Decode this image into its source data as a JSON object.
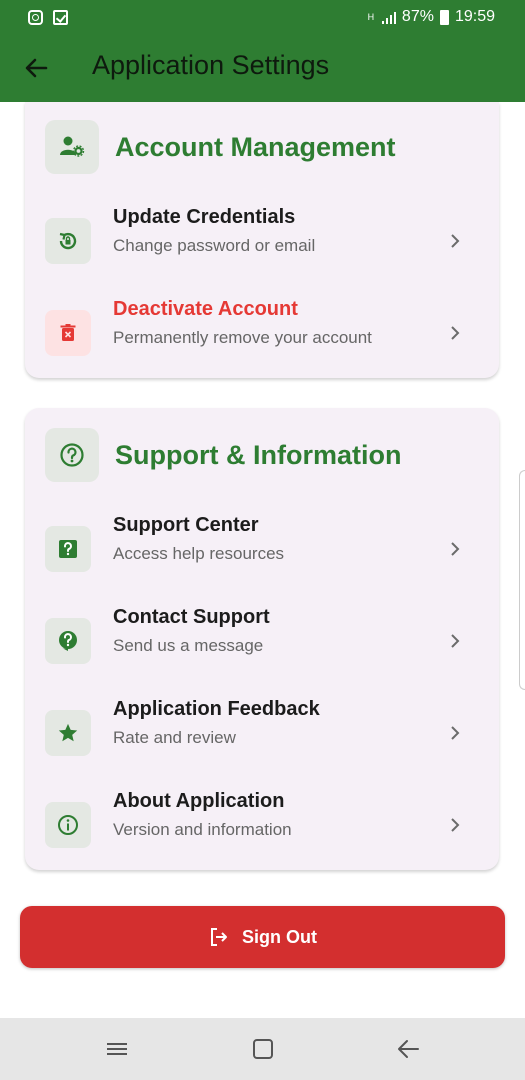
{
  "status_bar": {
    "battery": "87%",
    "time": "19:59",
    "network": "H"
  },
  "app_bar": {
    "title": "Application Settings"
  },
  "account_section": {
    "title": "Account Management",
    "items": [
      {
        "title": "Update Credentials",
        "subtitle": "Change password or email",
        "icon": "lock-reset-icon"
      },
      {
        "title": "Deactivate Account",
        "subtitle": "Permanently remove your account",
        "icon": "delete-icon"
      }
    ]
  },
  "support_section": {
    "title": "Support & Information",
    "items": [
      {
        "title": "Support Center",
        "subtitle": "Access help resources",
        "icon": "help-box-icon"
      },
      {
        "title": "Contact Support",
        "subtitle": "Send us a message",
        "icon": "question-bubble-icon"
      },
      {
        "title": "Application Feedback",
        "subtitle": "Rate and review",
        "icon": "star-icon"
      },
      {
        "title": "About Application",
        "subtitle": "Version and information",
        "icon": "info-icon"
      }
    ]
  },
  "sign_out": {
    "label": "Sign Out"
  },
  "colors": {
    "primary": "#2e7d32",
    "danger": "#e53935",
    "signout": "#d32f2f",
    "card": "#f6f0f7"
  }
}
